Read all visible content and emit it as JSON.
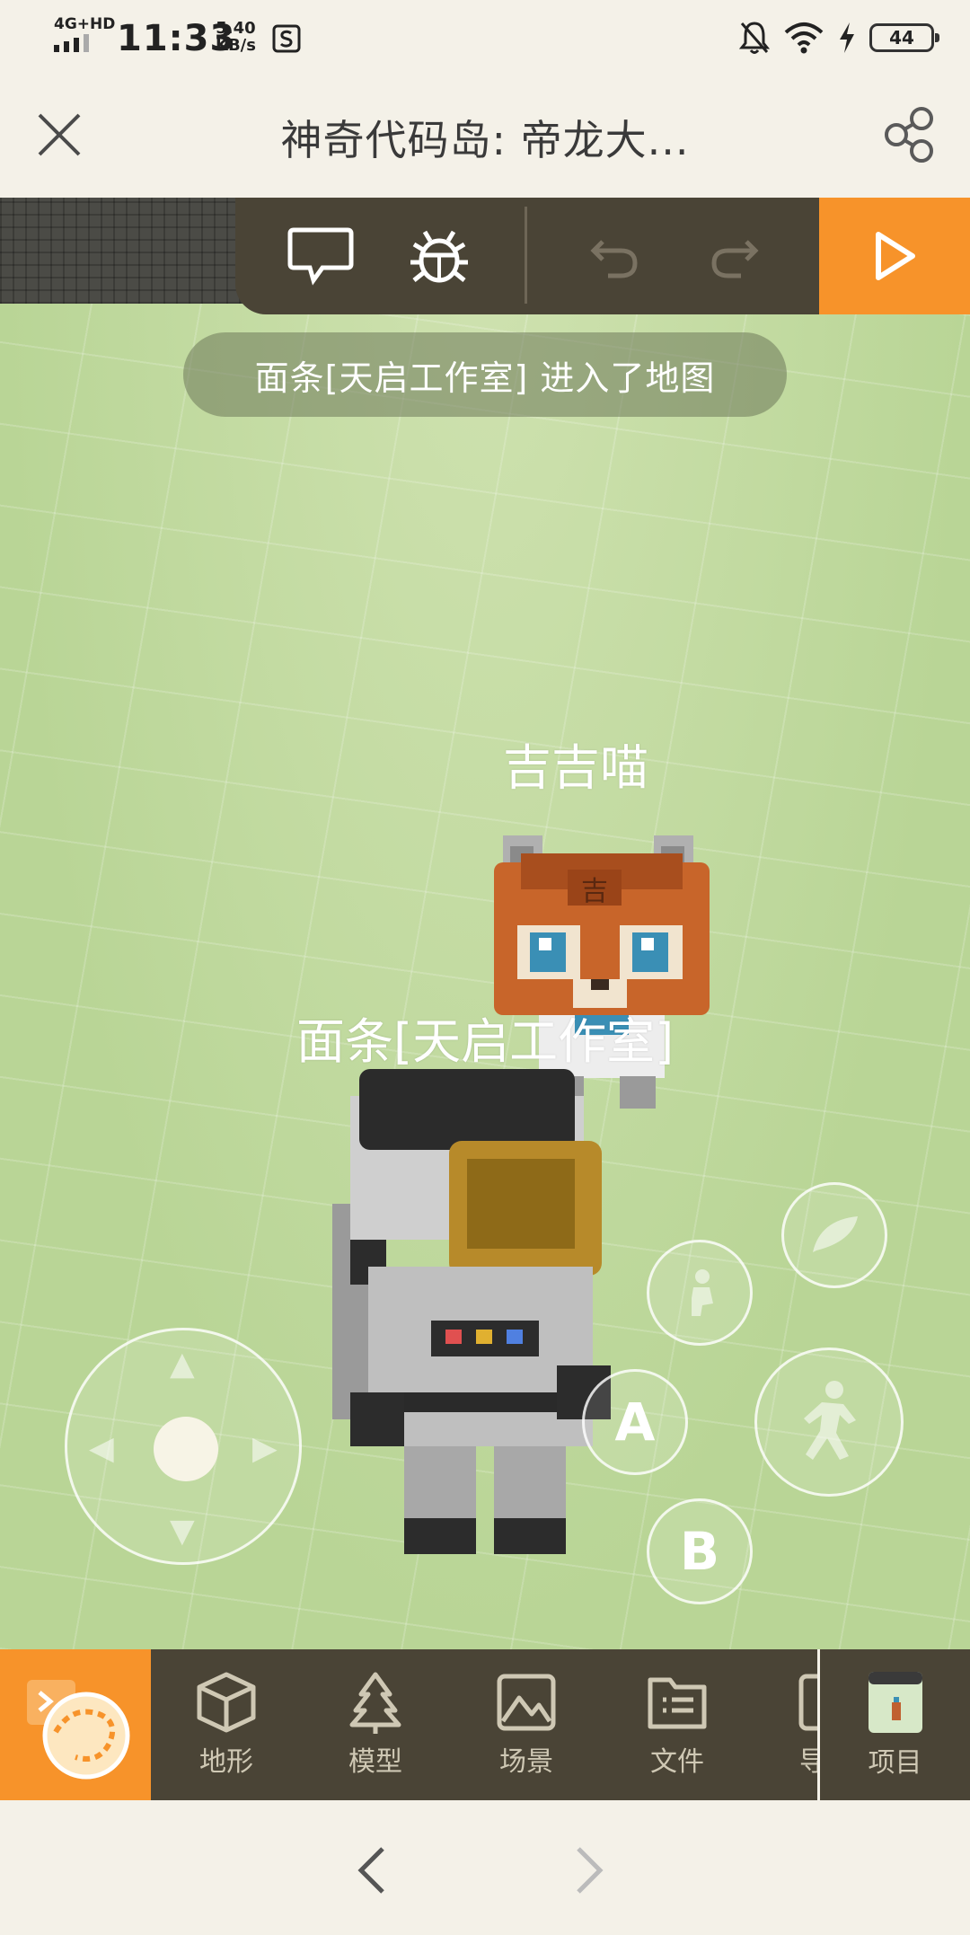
{
  "status_bar": {
    "network": "4G+HD",
    "time": "11:33",
    "speed_value": "5.40",
    "speed_unit": "KB/s",
    "battery": "44"
  },
  "title_bar": {
    "title": "神奇代码岛: 帝龙大..."
  },
  "viewport": {
    "toast": "面条[天启工作室] 进入了地图",
    "npc_name": "吉吉喵",
    "player_name": "面条[天启工作室]",
    "button_a": "A",
    "button_b": "B"
  },
  "bottom_bar": {
    "items": [
      {
        "label": "地形",
        "icon": "cube-icon"
      },
      {
        "label": "模型",
        "icon": "tree-icon"
      },
      {
        "label": "场景",
        "icon": "image-icon"
      },
      {
        "label": "文件",
        "icon": "folder-icon"
      },
      {
        "label": "导",
        "icon": "export-icon"
      }
    ],
    "project_label": "项目"
  },
  "colors": {
    "accent": "#f7932a",
    "toolbar": "#4a4436",
    "ground": "#b9d596",
    "background": "#f4f1e8"
  }
}
